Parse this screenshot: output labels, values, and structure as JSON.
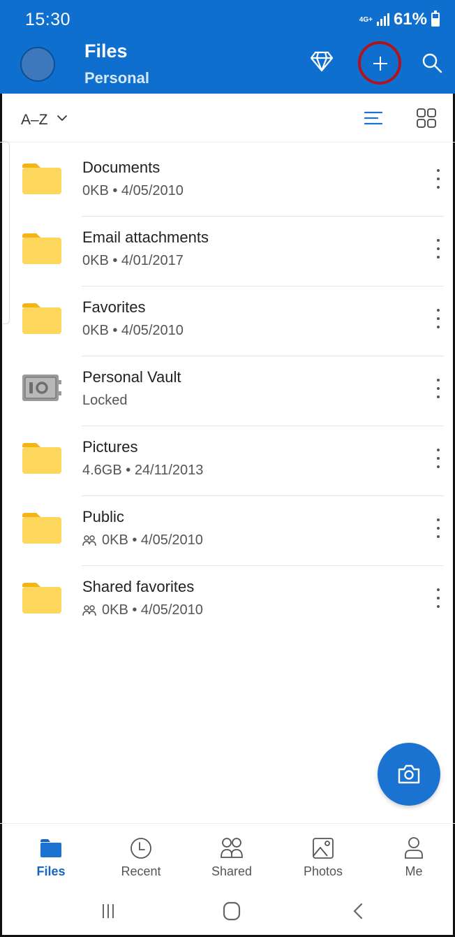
{
  "status_bar": {
    "time": "15:30",
    "network": "4G+",
    "battery_percent": "61%",
    "battery_level": 0.61,
    "icons": [
      "signal-icon",
      "battery-icon"
    ]
  },
  "header": {
    "title": "Files",
    "subtitle": "Personal",
    "actions": [
      "diamond-icon",
      "add-icon",
      "search-icon"
    ],
    "colors": {
      "header_bg": "#0f6fcf",
      "highlight_ring": "#b3121b"
    }
  },
  "sort_bar": {
    "sort_label": "A–Z",
    "view_icons": [
      "list-view-icon",
      "grid-view-icon"
    ]
  },
  "files": [
    {
      "name": "Documents",
      "meta": "0KB • 4/05/2010",
      "icon": "folder-icon",
      "shared": false
    },
    {
      "name": "Email attachments",
      "meta": "0KB • 4/01/2017",
      "icon": "folder-icon",
      "shared": false
    },
    {
      "name": "Favorites",
      "meta": "0KB • 4/05/2010",
      "icon": "folder-icon",
      "shared": false
    },
    {
      "name": "Personal Vault",
      "meta": "Locked",
      "icon": "vault-icon",
      "shared": false
    },
    {
      "name": "Pictures",
      "meta": "4.6GB • 24/11/2013",
      "icon": "folder-icon",
      "shared": false
    },
    {
      "name": "Public",
      "meta": "0KB • 4/05/2010",
      "icon": "folder-icon",
      "shared": true
    },
    {
      "name": "Shared favorites",
      "meta": "0KB • 4/05/2010",
      "icon": "folder-icon",
      "shared": true
    }
  ],
  "fab": {
    "icon": "camera-icon"
  },
  "bottom_nav": {
    "items": [
      {
        "label": "Files",
        "icon": "files-icon",
        "active": true
      },
      {
        "label": "Recent",
        "icon": "clock-icon",
        "active": false
      },
      {
        "label": "Shared",
        "icon": "people-icon",
        "active": false
      },
      {
        "label": "Photos",
        "icon": "photo-icon",
        "active": false
      },
      {
        "label": "Me",
        "icon": "person-icon",
        "active": false
      }
    ],
    "active_color": "#1565c0"
  },
  "system_nav": {
    "icons": [
      "recents-icon",
      "home-icon",
      "back-icon"
    ]
  }
}
